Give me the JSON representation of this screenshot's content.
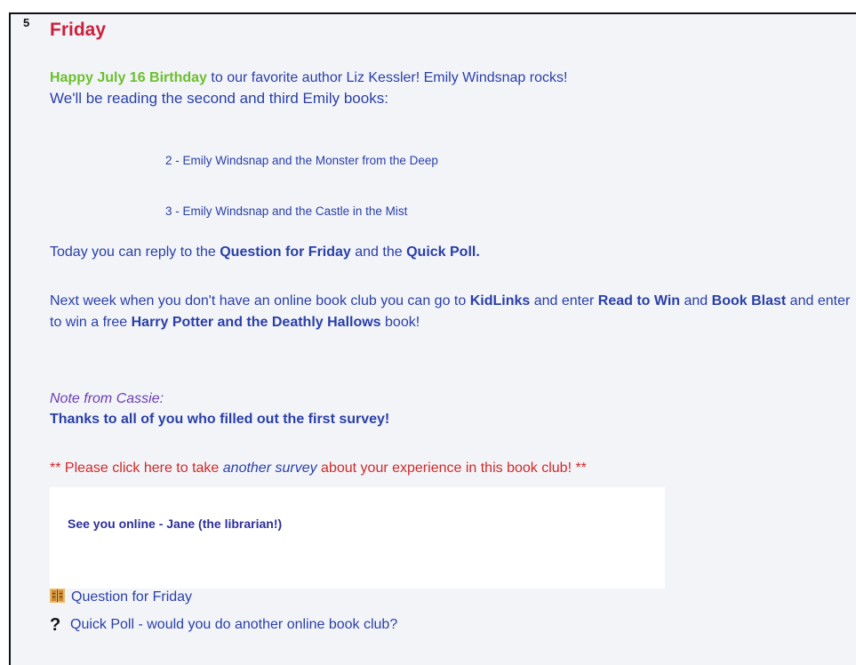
{
  "page_number": "5",
  "title": "Friday",
  "intro": {
    "birthday": "Happy July 16 Birthday",
    "text_a": " to our favorite author Liz Kessler!  Emily Windsnap rocks!",
    "text_b": "We'll be reading the second and third Emily books:"
  },
  "books": [
    "2 - Emily Windsnap and the Monster from the Deep",
    "3 - Emily Windsnap and the Castle in the Mist"
  ],
  "today": {
    "pre": "Today you can reply to the ",
    "link1": "Question for Friday",
    "mid": " and the ",
    "link2": "Quick Poll."
  },
  "next_week": {
    "t1": "Next week when you don't have an online book club you can go to ",
    "kidlinks": "KidLinks",
    "t2": " and enter ",
    "read_to_win": "Read to Win",
    "t3": " and ",
    "book_blast": "Book Blast",
    "t4": "  and enter to win a free ",
    "harry": "Harry Potter and the Deathly Hallows",
    "t5": " book!"
  },
  "note": {
    "label": "Note from Cassie:",
    "thanks": "Thanks to all of you who filled out the first survey!"
  },
  "survey": {
    "pre": "** Please click here to take ",
    "link": "another survey",
    "post": " about your experience in this book club! **"
  },
  "signoff": "See you online - Jane (the librarian!)",
  "links": {
    "question": "Question for Friday",
    "poll": "Quick Poll - would you do another online book club?"
  },
  "colors": {
    "title": "#cc1f3c",
    "body_blue": "#2a3fa8",
    "birthday_green": "#6cbf2d",
    "note_purple": "#6a3fb0",
    "survey_red": "#d02a2a"
  }
}
